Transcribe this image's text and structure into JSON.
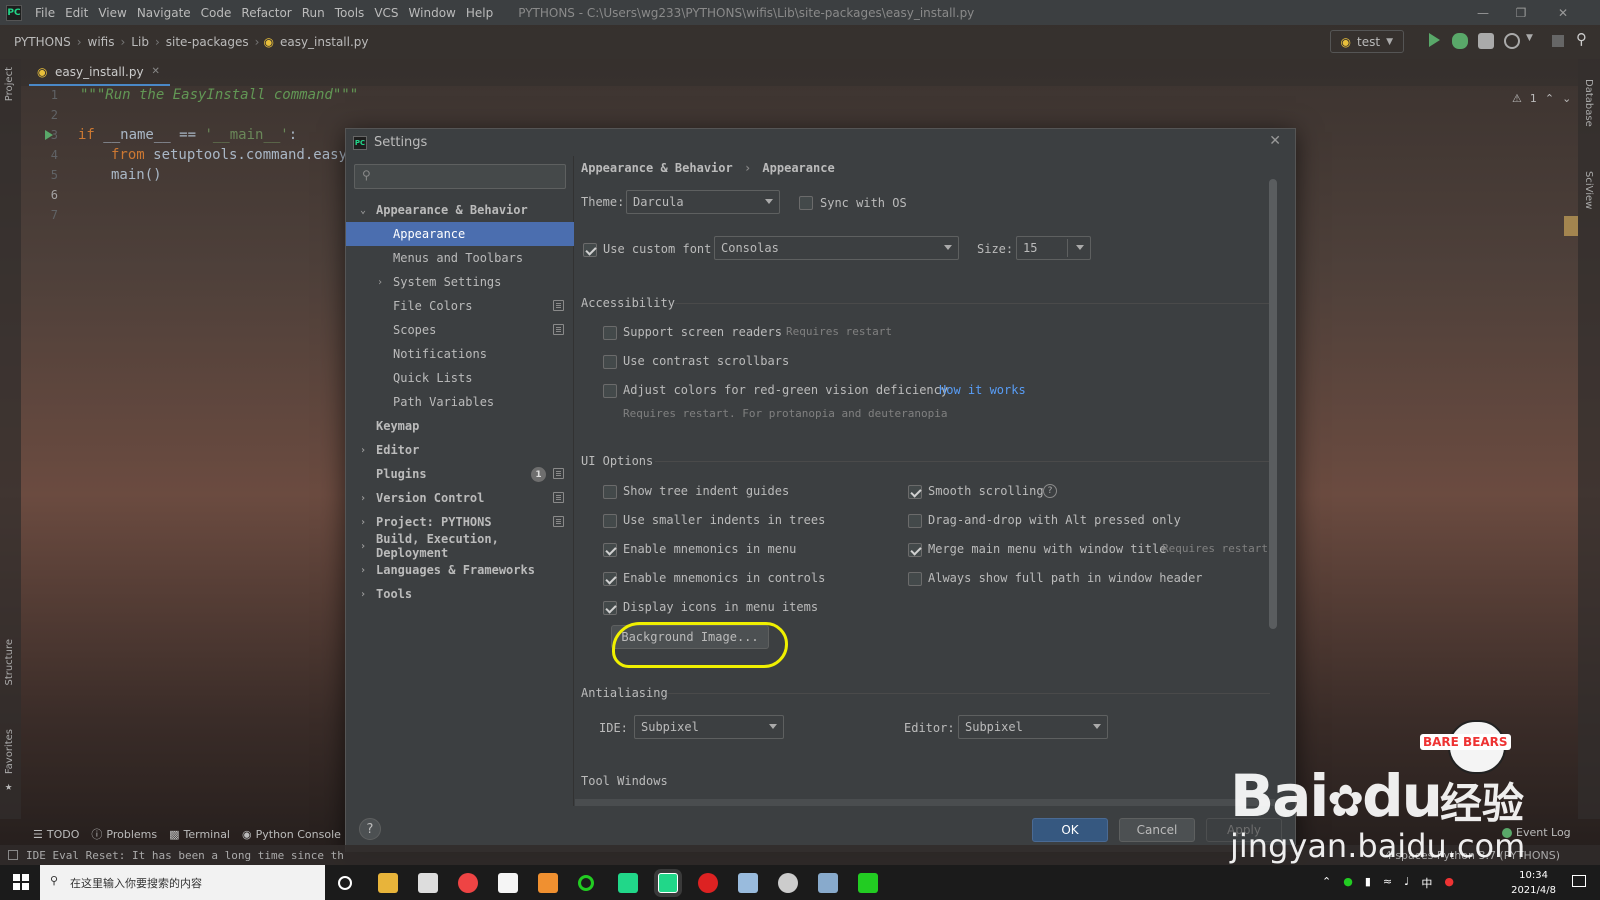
{
  "menubar": {
    "app_logo": "PC",
    "items": [
      "File",
      "Edit",
      "View",
      "Navigate",
      "Code",
      "Refactor",
      "Run",
      "Tools",
      "VCS",
      "Window",
      "Help"
    ],
    "window_title": "PYTHONS - C:\\Users\\wg233\\PYTHONS\\wifis\\Lib\\site-packages\\easy_install.py"
  },
  "navbar": {
    "breadcrumbs": [
      "PYTHONS",
      "wifis",
      "Lib",
      "site-packages",
      "easy_install.py"
    ],
    "run_config": "test"
  },
  "side": {
    "project": "Project",
    "structure": "Structure",
    "favorites": "Favorites",
    "database": "Database",
    "sciview": "SciView"
  },
  "editor": {
    "tab_label": "easy_install.py",
    "line_numbers": [
      "1",
      "2",
      "3",
      "4",
      "5",
      "6",
      "7"
    ],
    "lines": {
      "l1": "\"\"\"Run the EasyInstall command\"\"\"",
      "l3_kw": "if",
      "l3_rest": " __name__ == ",
      "l3_str": "'__main__'",
      "l3_end": ":",
      "l4_kw": "from",
      "l4_rest": " setuptools.command.easy",
      "l5": "main()"
    },
    "inspection_count": "1"
  },
  "dialog": {
    "title": "Settings",
    "icon": "PC",
    "search_placeholder": "",
    "tree": {
      "appearance_behavior": "Appearance & Behavior",
      "appearance": "Appearance",
      "menus_toolbars": "Menus and Toolbars",
      "system_settings": "System Settings",
      "file_colors": "File Colors",
      "scopes": "Scopes",
      "notifications": "Notifications",
      "quick_lists": "Quick Lists",
      "path_variables": "Path Variables",
      "keymap": "Keymap",
      "editor": "Editor",
      "plugins": "Plugins",
      "plugins_badge": "1",
      "version_control": "Version Control",
      "project": "Project: PYTHONS",
      "build": "Build, Execution, Deployment",
      "languages": "Languages & Frameworks",
      "tools": "Tools"
    },
    "breadcrumb": [
      "Appearance & Behavior",
      "Appearance"
    ],
    "theme_label": "Theme:",
    "theme_value": "Darcula",
    "sync_os": "Sync with OS",
    "custom_font_label": "Use custom font:",
    "custom_font_value": "Consolas",
    "size_label": "Size:",
    "size_value": "15",
    "accessibility": {
      "header": "Accessibility",
      "screen_readers": "Support screen readers",
      "screen_readers_hint": "Requires restart",
      "contrast_scrollbars": "Use contrast scrollbars",
      "red_green": "Adjust colors for red-green vision deficiency",
      "how_it_works": "How it works",
      "red_green_hint": "Requires restart. For protanopia and deuteranopia"
    },
    "ui_options": {
      "header": "UI Options",
      "tree_indent": "Show tree indent guides",
      "smaller_indents": "Use smaller indents in trees",
      "mnemonics_menu": "Enable mnemonics in menu",
      "mnemonics_controls": "Enable mnemonics in controls",
      "display_icons": "Display icons in menu items",
      "smooth_scrolling": "Smooth scrolling",
      "dnd_alt": "Drag-and-drop with Alt pressed only",
      "merge_menu": "Merge main menu with window title",
      "merge_menu_hint": "Requires restart",
      "full_path": "Always show full path in window header",
      "background_image": "Background Image..."
    },
    "antialiasing": {
      "header": "Antialiasing",
      "ide_label": "IDE:",
      "ide_value": "Subpixel",
      "editor_label": "Editor:",
      "editor_value": "Subpixel"
    },
    "tool_windows": "Tool Windows",
    "help": "?",
    "ok": "OK",
    "cancel": "Cancel",
    "apply": "Apply"
  },
  "bottom_tools": [
    "TODO",
    "Problems",
    "Terminal",
    "Python Console"
  ],
  "status": {
    "message": "IDE Eval Reset: It has been a long time since th",
    "right": "4 spaces  Python 3.7 (PYTHONS)",
    "event_log": "Event Log"
  },
  "taskbar": {
    "search_placeholder": "在这里输入你要搜索的内容",
    "time": "10:34",
    "date": "2021/4/8"
  },
  "watermark": {
    "brand": "Bai",
    "brand2": "du",
    "cn": "经验",
    "url": "jingyan.baidu.com",
    "bears": "BARE BEARS"
  },
  "colors": {
    "accent": "#4b6eaf",
    "ok_button": "#365880",
    "highlight": "#f0f000",
    "link": "#589df6"
  }
}
